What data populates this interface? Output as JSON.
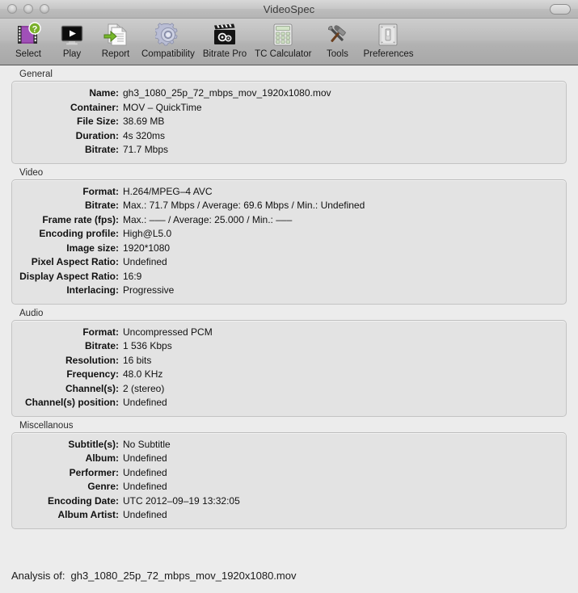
{
  "window": {
    "title": "VideoSpec",
    "controls": [
      "close-button",
      "minimize-button",
      "zoom-button"
    ],
    "toolbar_toggle": "toolbar-toggle-button"
  },
  "toolbar": {
    "items": [
      {
        "label": "Select",
        "icon": "film-strip-question-icon"
      },
      {
        "label": "Play",
        "icon": "monitor-play-icon"
      },
      {
        "label": "Report",
        "icon": "document-arrow-icon"
      },
      {
        "label": "Compatibility",
        "icon": "gear-icon"
      },
      {
        "label": "Bitrate Pro",
        "icon": "clapperboard-gears-icon"
      },
      {
        "label": "TC Calculator",
        "icon": "calculator-icon"
      },
      {
        "label": "Tools",
        "icon": "wrench-hammer-icon"
      },
      {
        "label": "Preferences",
        "icon": "light-switch-icon"
      }
    ]
  },
  "sections": [
    {
      "title": "General",
      "rows": [
        {
          "label": "Name:",
          "value": "gh3_1080_25p_72_mbps_mov_1920x1080.mov"
        },
        {
          "label": "Container:",
          "value": "MOV – QuickTime"
        },
        {
          "label": "File Size:",
          "value": "38.69 MB"
        },
        {
          "label": "Duration:",
          "value": "4s 320ms"
        },
        {
          "label": "Bitrate:",
          "value": "71.7 Mbps"
        }
      ]
    },
    {
      "title": "Video",
      "rows": [
        {
          "label": "Format:",
          "value": "H.264/MPEG–4 AVC"
        },
        {
          "label": "Bitrate:",
          "value": "Max.: 71.7 Mbps / Average: 69.6 Mbps / Min.: Undefined"
        },
        {
          "label": "Frame rate (fps):",
          "value": "Max.: ––– / Average: 25.000 / Min.: –––"
        },
        {
          "label": "Encoding profile:",
          "value": "High@L5.0"
        },
        {
          "label": "Image size:",
          "value": "1920*1080"
        },
        {
          "label": "Pixel Aspect Ratio:",
          "value": "Undefined"
        },
        {
          "label": "Display Aspect Ratio:",
          "value": "16:9"
        },
        {
          "label": "Interlacing:",
          "value": "Progressive"
        }
      ]
    },
    {
      "title": "Audio",
      "rows": [
        {
          "label": "Format:",
          "value": "Uncompressed PCM"
        },
        {
          "label": "Bitrate:",
          "value": "1 536 Kbps"
        },
        {
          "label": "Resolution:",
          "value": "16 bits"
        },
        {
          "label": "Frequency:",
          "value": "48.0 KHz"
        },
        {
          "label": "Channel(s):",
          "value": "2 (stereo)"
        },
        {
          "label": "Channel(s) position:",
          "value": "Undefined"
        }
      ]
    },
    {
      "title": "Miscellanous",
      "rows": [
        {
          "label": "Subtitle(s):",
          "value": "No Subtitle"
        },
        {
          "label": "Album:",
          "value": "Undefined"
        },
        {
          "label": "Performer:",
          "value": "Undefined"
        },
        {
          "label": "Genre:",
          "value": "Undefined"
        },
        {
          "label": "Encoding Date:",
          "value": "UTC 2012–09–19 13:32:05"
        },
        {
          "label": "Album Artist:",
          "value": "Undefined"
        }
      ]
    }
  ],
  "statusbar": {
    "label": "Analysis of:",
    "value": "gh3_1080_25p_72_mbps_mov_1920x1080.mov"
  }
}
